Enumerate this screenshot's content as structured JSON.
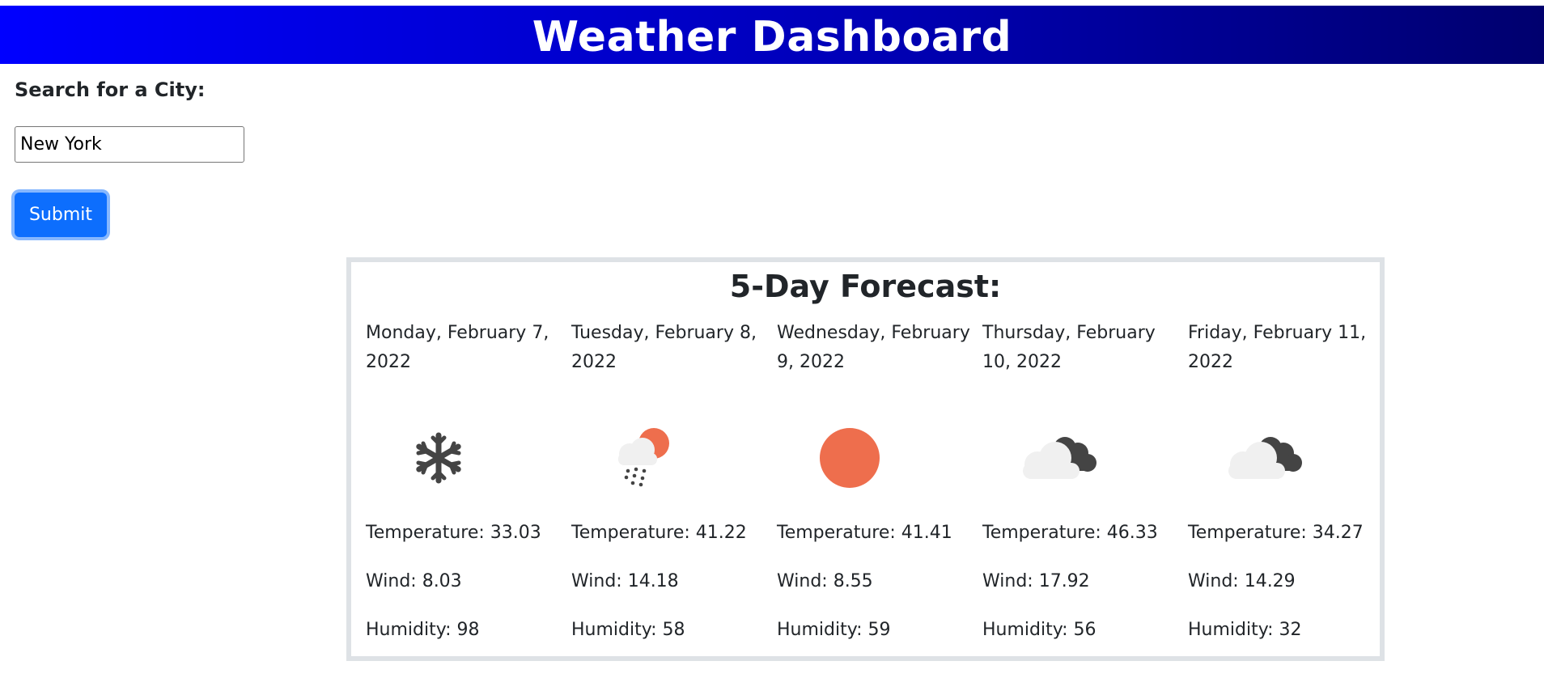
{
  "header": {
    "title": "Weather Dashboard"
  },
  "search": {
    "label": "Search for a City:",
    "value": "New York",
    "submit_label": "Submit"
  },
  "forecast": {
    "title": "5-Day Forecast:",
    "days": [
      {
        "date": "Monday, February 7, 2022",
        "icon": "snow-icon",
        "temperature": "Temperature: 33.03",
        "wind": "Wind: 8.03",
        "humidity": "Humidity: 98"
      },
      {
        "date": "Tuesday, February 8, 2022",
        "icon": "rain-sun-icon",
        "temperature": "Temperature: 41.22",
        "wind": "Wind: 14.18",
        "humidity": "Humidity: 58"
      },
      {
        "date": "Wednesday, February 9, 2022",
        "icon": "sun-icon",
        "temperature": "Temperature: 41.41",
        "wind": "Wind: 8.55",
        "humidity": "Humidity: 59"
      },
      {
        "date": "Thursday, February 10, 2022",
        "icon": "cloudy-icon",
        "temperature": "Temperature: 46.33",
        "wind": "Wind: 17.92",
        "humidity": "Humidity: 56"
      },
      {
        "date": "Friday, February 11, 2022",
        "icon": "cloudy-icon",
        "temperature": "Temperature: 34.27",
        "wind": "Wind: 14.29",
        "humidity": "Humidity: 32"
      }
    ]
  },
  "colors": {
    "header_gradient_start": "#0000ff",
    "header_gradient_end": "#00006e",
    "button": "#0d6efd",
    "icon_orange": "#ee6e4d",
    "icon_dark": "#444444",
    "icon_light": "#f0f0f0"
  }
}
